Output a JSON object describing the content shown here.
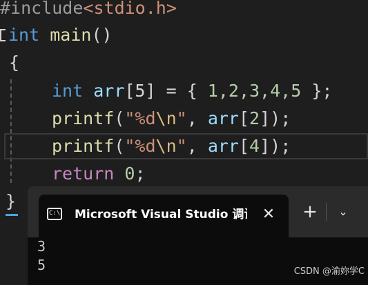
{
  "editor": {
    "include": {
      "directive": "#include",
      "path": "<stdio.h>"
    },
    "main_sig": {
      "type": "int",
      "name": "main",
      "parens": "()"
    },
    "open_brace": "{",
    "decl": {
      "type": "int",
      "name": "arr",
      "index": "[5]",
      "eq": " = ",
      "lbrace": "{ ",
      "values": "1,2,3,4,5",
      "rbrace": " };"
    },
    "printf1": {
      "fn": "printf",
      "open": "(",
      "fmt_a": "\"%d",
      "fmt_esc": "\\n",
      "fmt_b": "\"",
      "sep": ", ",
      "var": "arr",
      "idx_open": "[",
      "idx": "2",
      "idx_close": "]",
      "close": ");"
    },
    "printf2": {
      "fn": "printf",
      "open": "(",
      "fmt_a": "\"%d",
      "fmt_esc": "\\n",
      "fmt_b": "\"",
      "sep": ", ",
      "var": "arr",
      "idx_open": "[",
      "idx": "4",
      "idx_close": "]",
      "close": ");"
    },
    "ret": {
      "kw": "return",
      "value": "0",
      "semi": ";"
    },
    "close_brace": "}"
  },
  "terminal": {
    "tab_title": "Microsoft Visual Studio 调试控制台",
    "tab_icon_glyph": "C:\\",
    "close_glyph": "✕",
    "new_tab_glyph": "+",
    "dropdown_glyph": "⌄",
    "output": [
      "3",
      "5"
    ]
  },
  "watermark": "CSDN @渝妳学C",
  "colors": {
    "background": "#1e1e1e",
    "keyword": "#569cd6",
    "function": "#dcdcaa",
    "string": "#ce9178",
    "number": "#b5cea8",
    "variable": "#9cdcfe",
    "terminal_bg": "#0c0c0c",
    "tabbar_bg": "#2b2b2b"
  }
}
